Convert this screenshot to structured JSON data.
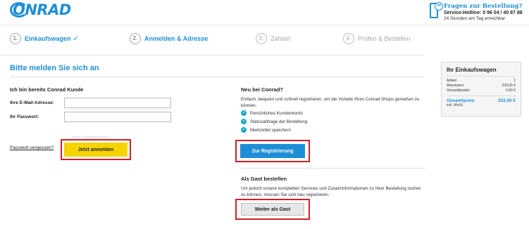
{
  "header": {
    "logo_text": "ONRAD",
    "logo_icon": "conrad-logo-c",
    "hotline_icon": "phone-24-icon",
    "hotline_badge": "24",
    "hotline_title": "Fragen zur Bestellung?",
    "hotline_number": "Service-Hotline: 0 96 04 / 40 87 88",
    "hotline_sub": "24 Stunden am Tag erreichbar"
  },
  "steps": [
    {
      "num": "1.",
      "label": "Einkaufswagen",
      "state": "done",
      "check": "✓"
    },
    {
      "num": "2.",
      "label": "Anmelden & Adresse",
      "state": "active"
    },
    {
      "num": "3.",
      "label": "Zahlart",
      "state": "inactive"
    },
    {
      "num": "4.",
      "label": "Prüfen & Bestellen",
      "state": "inactive"
    }
  ],
  "page_title": "Bitte melden Sie sich an",
  "login": {
    "heading": "Ich bin bereits Conrad Kunde",
    "email_label": "Ihre E-Mail-Adresse:",
    "email_value": "",
    "password_label": "Ihr Passwort:",
    "password_value": "",
    "faint_link": "oder Kundennummer",
    "forgot": "Passwort vergessen?",
    "submit": "Jetzt anmelden"
  },
  "register": {
    "heading": "Neu bei Conrad?",
    "intro": "Einfach, bequem und schnell registrieren, um die Vorteile Ihres Conrad Shops genießen zu können.",
    "benefits": [
      "Persönliches Kundenkonto",
      "Statusabfrage der Bestellung",
      "Merkzettel speichern"
    ],
    "button": "Zur Registrierung"
  },
  "guest": {
    "heading": "Als Gast bestellen",
    "text": "Um jedoch unsere kompletten Services und Zusatzinformationen zu Ihrer Bestellung nutzen zu können, müssen Sie sich neu registrieren.",
    "button": "Weiter als Gast"
  },
  "cart": {
    "title": "Ihr Einkaufswagen",
    "rows": [
      {
        "label": "Artikel",
        "value": "1"
      },
      {
        "label": "Warenwert",
        "value": "333,00 €"
      },
      {
        "label": "Versandkosten",
        "value": "0,00 €"
      }
    ],
    "total_label": "Gesamtpreis",
    "total_value": "333,00 €",
    "total_sub": "inkl. MwSt."
  },
  "colors": {
    "accent": "#1e8fd6",
    "highlight": "#d0202a",
    "primary_button": "#f5d400"
  }
}
